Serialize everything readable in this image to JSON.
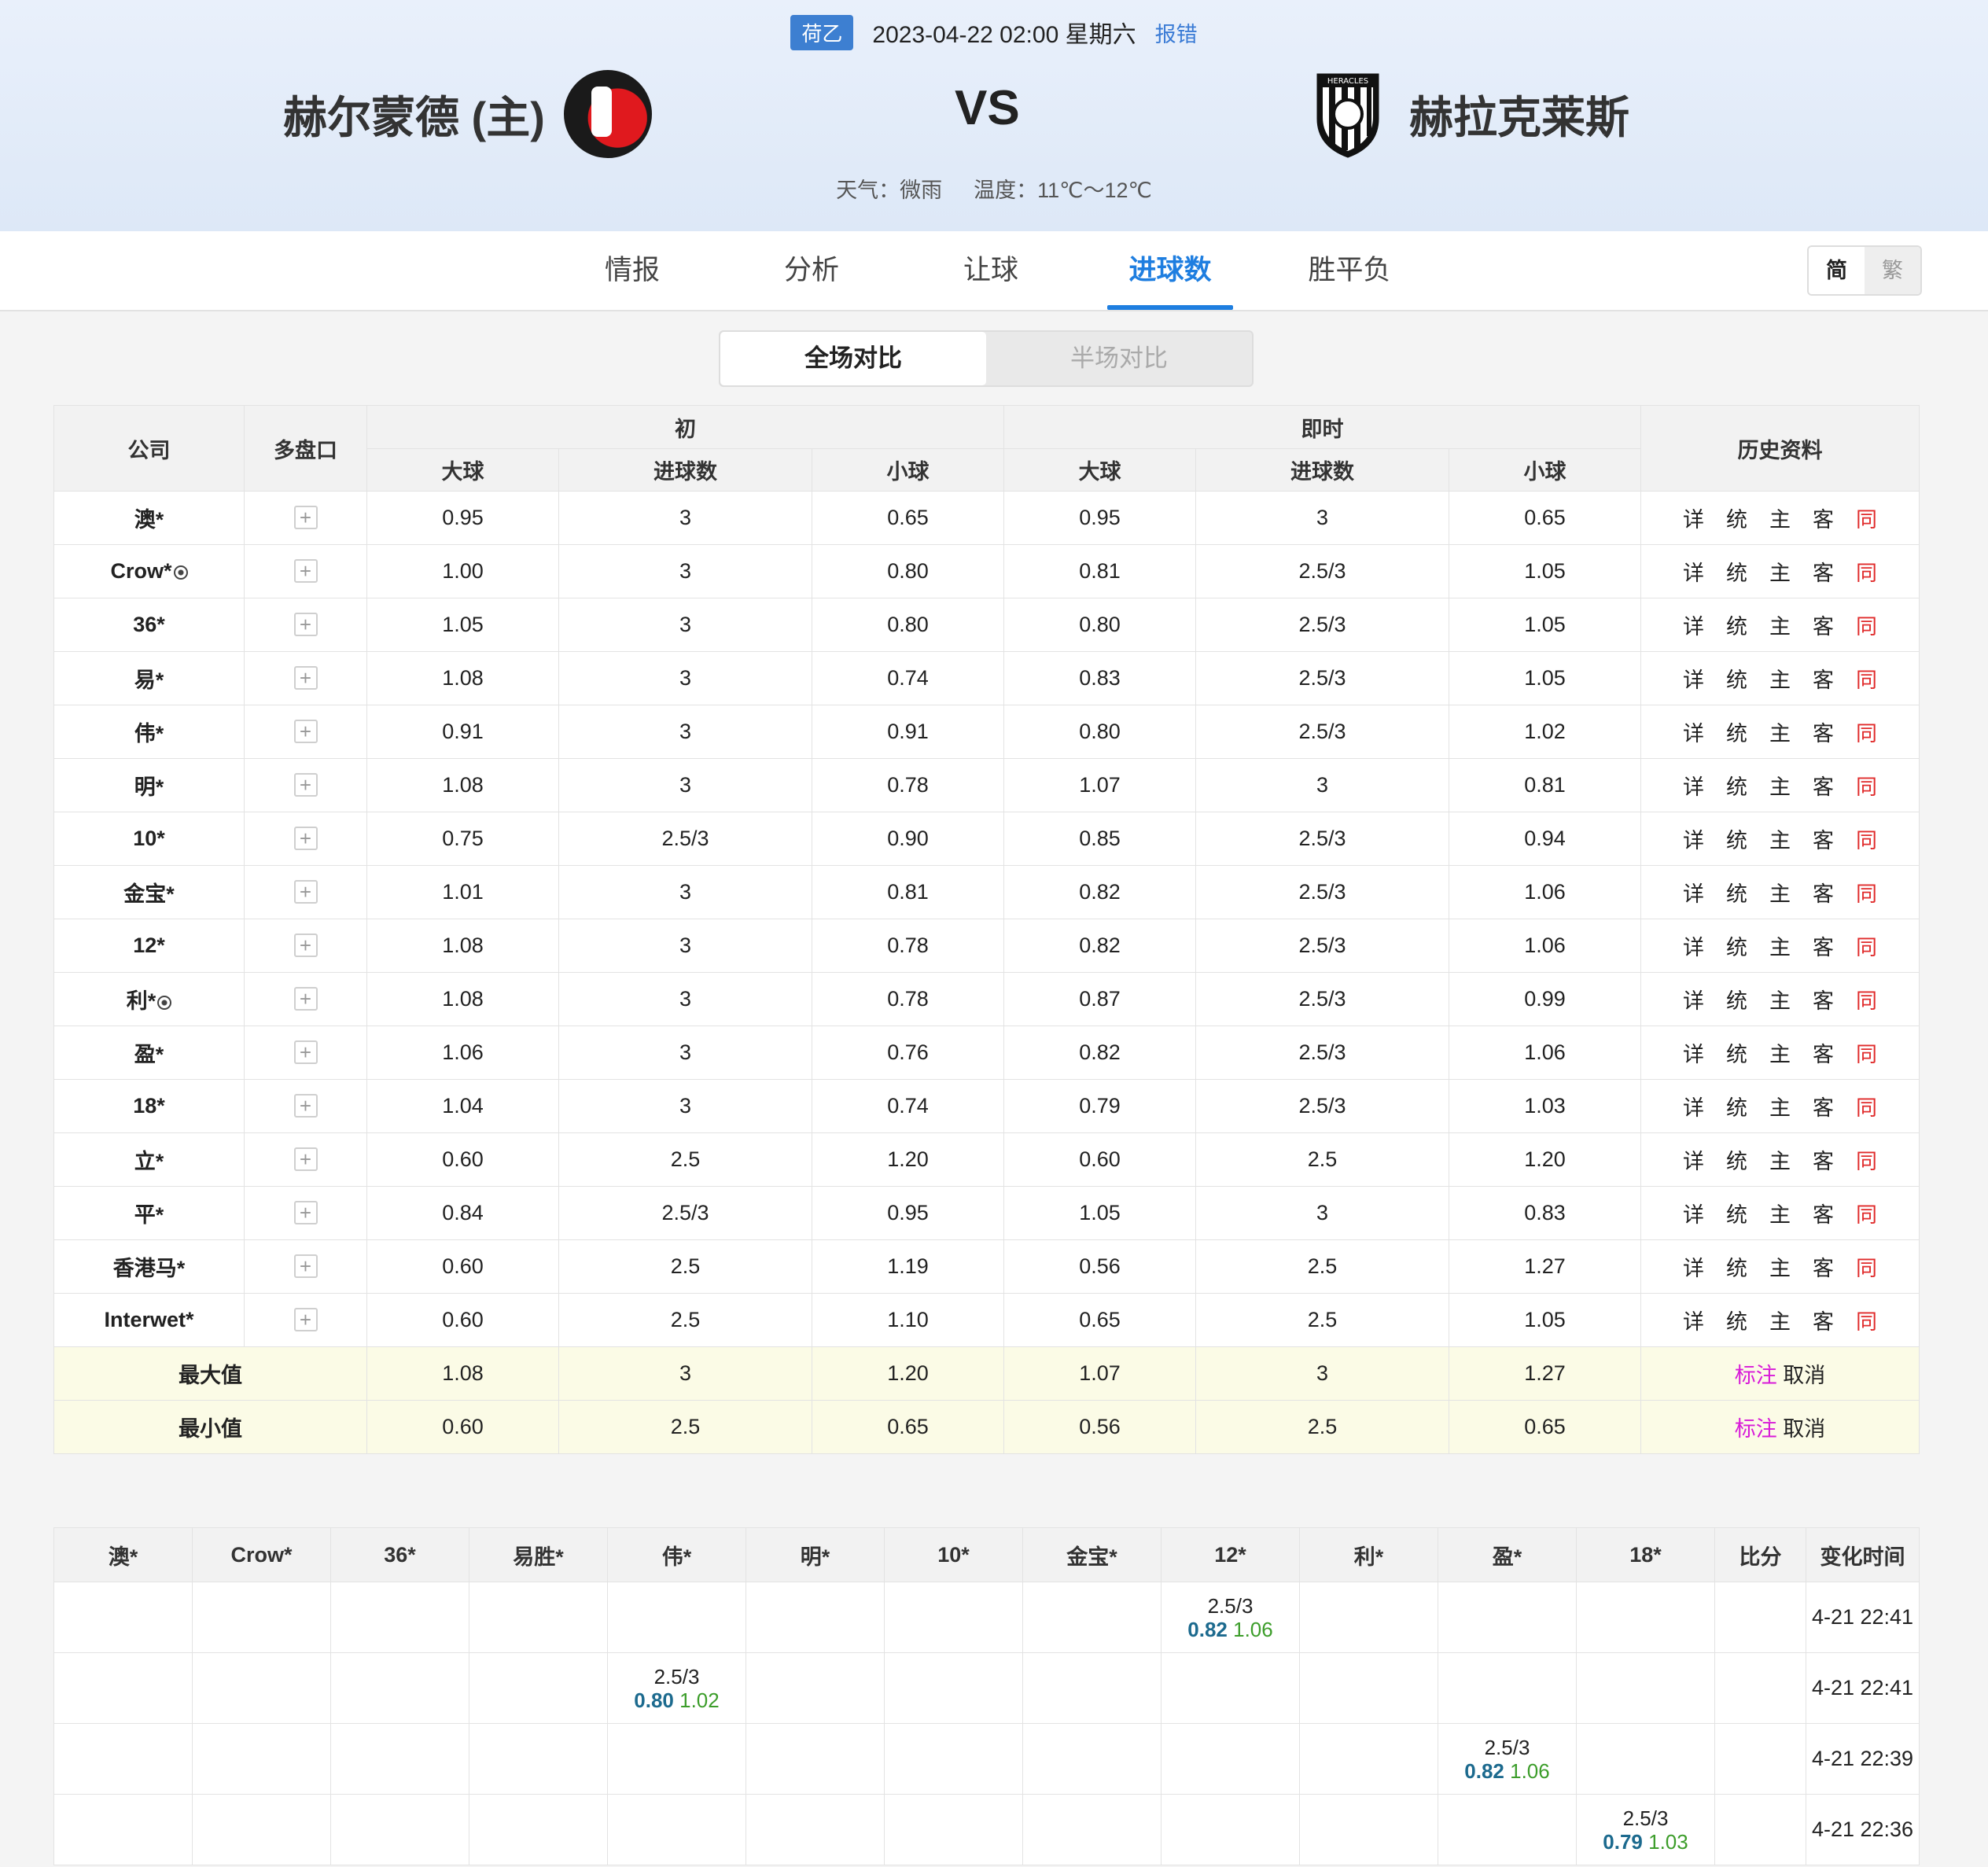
{
  "match": {
    "league": "荷乙",
    "datetime": "2023-04-22 02:00",
    "weekday": "星期六",
    "report_label": "报错",
    "home_team": "赫尔蒙德 (主)",
    "away_team": "赫拉克莱斯",
    "vs_label": "VS",
    "weather": "天气：微雨",
    "temperature": "温度：11℃～12℃"
  },
  "nav": {
    "tabs": [
      {
        "label": "情报"
      },
      {
        "label": "分析"
      },
      {
        "label": "让球"
      },
      {
        "label": "进球数",
        "active": true
      },
      {
        "label": "胜平负"
      }
    ],
    "lang_simplified": "简",
    "lang_traditional": "繁"
  },
  "segment": {
    "full": "全场对比",
    "half": "半场对比"
  },
  "table": {
    "headers": {
      "company": "公司",
      "multi": "多盘口",
      "initial": "初",
      "live": "即时",
      "history": "历史资料",
      "over": "大球",
      "goals": "进球数",
      "under": "小球"
    },
    "history_links": [
      "详",
      "统",
      "主",
      "客",
      "同"
    ],
    "rows": [
      {
        "company": "澳*",
        "ball": false,
        "i_over": "0.95",
        "i_line": "3",
        "i_under": "0.65",
        "l_over": "0.95",
        "l_line": "3",
        "l_under": "0.65"
      },
      {
        "company": "Crow*",
        "ball": true,
        "i_over": "1.00",
        "i_line": "3",
        "i_under": "0.80",
        "l_over": "0.81",
        "l_line": "2.5/3",
        "l_under": "1.05"
      },
      {
        "company": "36*",
        "ball": false,
        "i_over": "1.05",
        "i_line": "3",
        "i_under": "0.80",
        "l_over": "0.80",
        "l_line": "2.5/3",
        "l_under": "1.05"
      },
      {
        "company": "易*",
        "ball": false,
        "i_over": "1.08",
        "i_line": "3",
        "i_under": "0.74",
        "l_over": "0.83",
        "l_line": "2.5/3",
        "l_under": "1.05"
      },
      {
        "company": "伟*",
        "ball": false,
        "i_over": "0.91",
        "i_line": "3",
        "i_under": "0.91",
        "l_over": "0.80",
        "l_line": "2.5/3",
        "l_under": "1.02"
      },
      {
        "company": "明*",
        "ball": false,
        "i_over": "1.08",
        "i_line": "3",
        "i_under": "0.78",
        "l_over": "1.07",
        "l_line": "3",
        "l_under": "0.81"
      },
      {
        "company": "10*",
        "ball": false,
        "i_over": "0.75",
        "i_line": "2.5/3",
        "i_under": "0.90",
        "l_over": "0.85",
        "l_line": "2.5/3",
        "l_under": "0.94"
      },
      {
        "company": "金宝*",
        "ball": false,
        "i_over": "1.01",
        "i_line": "3",
        "i_under": "0.81",
        "l_over": "0.82",
        "l_line": "2.5/3",
        "l_under": "1.06"
      },
      {
        "company": "12*",
        "ball": false,
        "i_over": "1.08",
        "i_line": "3",
        "i_under": "0.78",
        "l_over": "0.82",
        "l_line": "2.5/3",
        "l_under": "1.06"
      },
      {
        "company": "利*",
        "ball": true,
        "i_over": "1.08",
        "i_line": "3",
        "i_under": "0.78",
        "l_over": "0.87",
        "l_line": "2.5/3",
        "l_under": "0.99"
      },
      {
        "company": "盈*",
        "ball": false,
        "i_over": "1.06",
        "i_line": "3",
        "i_under": "0.76",
        "l_over": "0.82",
        "l_line": "2.5/3",
        "l_under": "1.06"
      },
      {
        "company": "18*",
        "ball": false,
        "i_over": "1.04",
        "i_line": "3",
        "i_under": "0.74",
        "l_over": "0.79",
        "l_line": "2.5/3",
        "l_under": "1.03"
      },
      {
        "company": "立*",
        "ball": false,
        "i_over": "0.60",
        "i_line": "2.5",
        "i_under": "1.20",
        "l_over": "0.60",
        "l_line": "2.5",
        "l_under": "1.20"
      },
      {
        "company": "平*",
        "ball": false,
        "i_over": "0.84",
        "i_line": "2.5/3",
        "i_under": "0.95",
        "l_over": "1.05",
        "l_line": "3",
        "l_under": "0.83"
      },
      {
        "company": "香港马*",
        "ball": false,
        "i_over": "0.60",
        "i_line": "2.5",
        "i_under": "1.19",
        "l_over": "0.56",
        "l_line": "2.5",
        "l_under": "1.27"
      },
      {
        "company": "Interwet*",
        "ball": false,
        "i_over": "0.60",
        "i_line": "2.5",
        "i_under": "1.10",
        "l_over": "0.65",
        "l_line": "2.5",
        "l_under": "1.05"
      }
    ],
    "summary": [
      {
        "label": "最大值",
        "i_over": "1.08",
        "i_line": "3",
        "i_under": "1.20",
        "l_over": "1.07",
        "l_line": "3",
        "l_under": "1.27"
      },
      {
        "label": "最小值",
        "i_over": "0.60",
        "i_line": "2.5",
        "i_under": "0.65",
        "l_over": "0.56",
        "l_line": "2.5",
        "l_under": "0.65"
      }
    ],
    "mark_label": "标注",
    "cancel_label": "取消"
  },
  "changes": {
    "headers": [
      "澳*",
      "Crow*",
      "36*",
      "易胜*",
      "伟*",
      "明*",
      "10*",
      "金宝*",
      "12*",
      "利*",
      "盈*",
      "18*",
      "比分",
      "变化时间"
    ],
    "rows": [
      {
        "col": 8,
        "line": "2.5/3",
        "over": "0.82",
        "under": "1.06",
        "time": "4-21 22:41"
      },
      {
        "col": 4,
        "line": "2.5/3",
        "over": "0.80",
        "under": "1.02",
        "time": "4-21 22:41"
      },
      {
        "col": 10,
        "line": "2.5/3",
        "over": "0.82",
        "under": "1.06",
        "time": "4-21 22:39"
      },
      {
        "col": 11,
        "line": "2.5/3",
        "over": "0.79",
        "under": "1.03",
        "time": "4-21 22:36"
      }
    ]
  }
}
